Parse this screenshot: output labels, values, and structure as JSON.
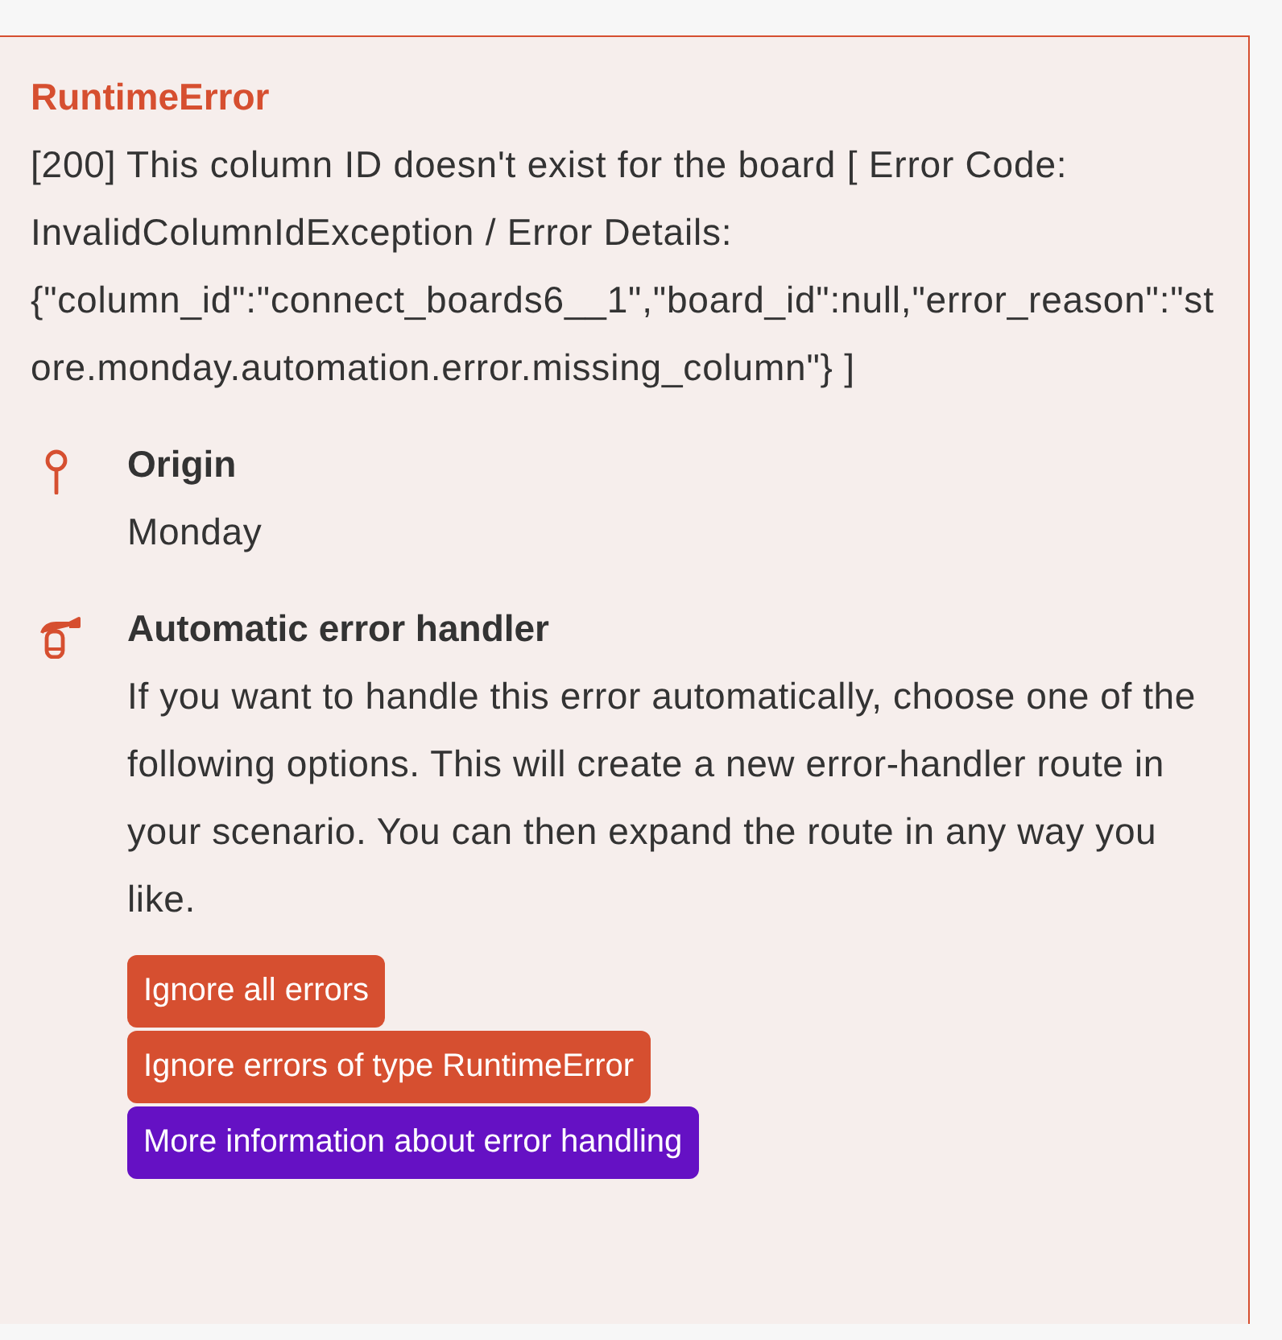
{
  "error": {
    "title": "RuntimeError",
    "message": "[200] This column ID doesn't exist for the board [ Error Code: InvalidColumnIdException / Error Details: {\"column_id\":\"connect_boards6__1\",\"board_id\":null,\"error_reason\":\"store.monday.automation.error.missing_column\"} ]"
  },
  "sections": [
    {
      "kind": "origin",
      "heading": "Origin",
      "text": "Monday"
    },
    {
      "kind": "handler",
      "heading": "Automatic error handler",
      "text": "If you want to handle this error automatically, choose one of the following options. This will create a new error-handler route in your scenario. You can then expand the route in any way you like.",
      "buttons": [
        {
          "label": "Ignore all errors",
          "kind": "action"
        },
        {
          "label": "Ignore errors of type RuntimeError",
          "kind": "action"
        },
        {
          "label": "More information about error handling",
          "kind": "link"
        }
      ]
    }
  ]
}
